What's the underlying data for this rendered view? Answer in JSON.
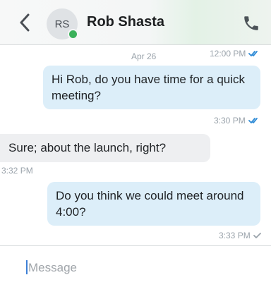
{
  "header": {
    "avatar_initials": "RS",
    "contact_name": "Rob Shasta",
    "presence_color": "#3bb15a",
    "back_icon": "chevron-left-icon",
    "call_icon": "phone-icon"
  },
  "messages": [
    {
      "direction": "outgoing",
      "date": "Apr 26",
      "time": "12:00 PM",
      "status": "read",
      "text": "Hi Rob, do you have time for a quick meeting?"
    },
    {
      "direction": "outgoing",
      "time": "3:30 PM",
      "status": "read",
      "text": ""
    },
    {
      "direction": "incoming",
      "text": "Sure; about the launch, right?",
      "time": "3:32 PM"
    },
    {
      "direction": "outgoing",
      "text": "Do you think we could meet around 4:00?",
      "time": "3:33 PM",
      "status": "delivered"
    }
  ],
  "composer": {
    "placeholder": "Message"
  },
  "colors": {
    "outgoing_bubble": "#dceef9",
    "incoming_bubble": "#eeeff1",
    "read_check": "#2f8bd6",
    "delivered_check": "#9aa3ab"
  }
}
